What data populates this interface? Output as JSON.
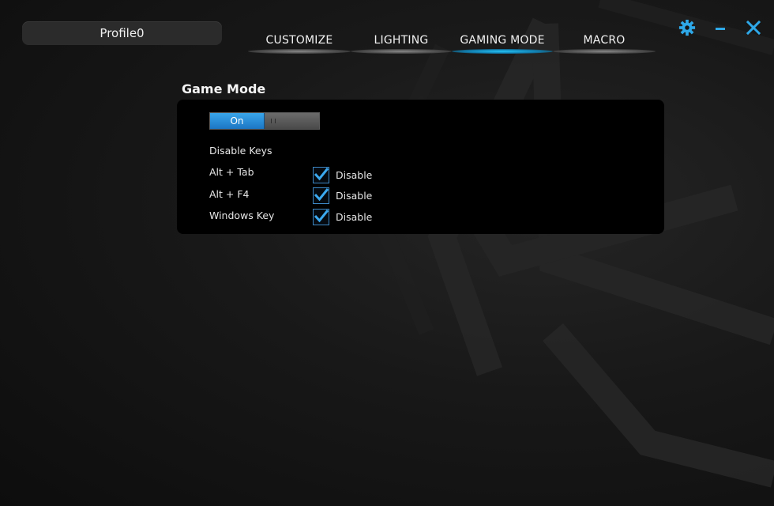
{
  "profile": {
    "name": "Profile0"
  },
  "tabs": [
    {
      "label": "CUSTOMIZE",
      "active": false
    },
    {
      "label": "LIGHTING",
      "active": false
    },
    {
      "label": "GAMING MODE",
      "active": true
    },
    {
      "label": "MACRO",
      "active": false
    }
  ],
  "window_controls": {
    "settings_icon": "gear-icon",
    "minimize_icon": "minimize-icon",
    "close_icon": "close-icon",
    "icon_color": "#2ea8e8"
  },
  "game_mode": {
    "title": "Game Mode",
    "toggle": {
      "on_label": "On",
      "state": "on"
    },
    "disable_keys_label": "Disable Keys",
    "keys": [
      {
        "name": "Alt + Tab",
        "option_label": "Disable",
        "checked": true
      },
      {
        "name": "Alt + F4",
        "option_label": "Disable",
        "checked": true
      },
      {
        "name": "Windows Key",
        "option_label": "Disable",
        "checked": true
      }
    ]
  },
  "colors": {
    "accent": "#2ea8e8",
    "toggle_on": "#2a8fd8",
    "panel_bg": "#000000"
  }
}
